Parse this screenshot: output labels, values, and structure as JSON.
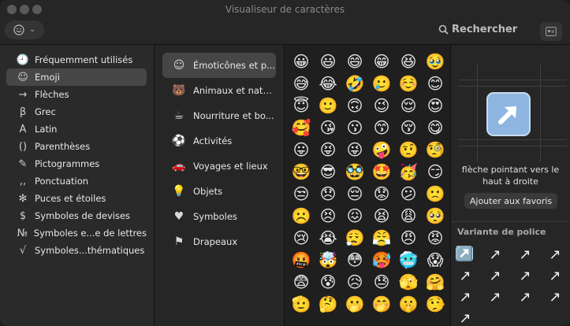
{
  "window": {
    "title": "Visualiseur de caractères"
  },
  "toolbar": {
    "search_label": "Rechercher"
  },
  "sidebar": {
    "items": [
      {
        "icon": "clock-icon",
        "glyph": "🕘",
        "label": "Fréquemment utilisés"
      },
      {
        "icon": "smiley-icon",
        "glyph": "☺",
        "label": "Emoji"
      },
      {
        "icon": "arrow-icon",
        "glyph": "→",
        "label": "Flèches"
      },
      {
        "icon": "beta-icon",
        "glyph": "β",
        "label": "Grec"
      },
      {
        "icon": "latin-a-icon",
        "glyph": "A",
        "label": "Latin"
      },
      {
        "icon": "parentheses-icon",
        "glyph": "()",
        "label": "Parenthèses"
      },
      {
        "icon": "pictogram-icon",
        "glyph": "✎",
        "label": "Pictogrammes"
      },
      {
        "icon": "punctuation-icon",
        "glyph": ",,",
        "label": "Ponctuation"
      },
      {
        "icon": "bullets-icon",
        "glyph": "✻",
        "label": "Puces et étoiles"
      },
      {
        "icon": "dollar-icon",
        "glyph": "$",
        "label": "Symboles de devises"
      },
      {
        "icon": "numero-icon",
        "glyph": "№",
        "label": "Symboles e...e de lettres"
      },
      {
        "icon": "sqrt-icon",
        "glyph": "√",
        "label": "Symboles...thématiques"
      }
    ],
    "selected_index": 1
  },
  "categories": {
    "items": [
      {
        "icon": "smiley-icon",
        "glyph": "☺",
        "label": "Émoticônes et p..."
      },
      {
        "icon": "bear-icon",
        "glyph": "🐻",
        "label": "Animaux et natu..."
      },
      {
        "icon": "cup-icon",
        "glyph": "☕",
        "label": "Nourriture et bo..."
      },
      {
        "icon": "ball-icon",
        "glyph": "⚽",
        "label": "Activités"
      },
      {
        "icon": "car-icon",
        "glyph": "🚗",
        "label": "Voyages et lieux"
      },
      {
        "icon": "bulb-icon",
        "glyph": "💡",
        "label": "Objets"
      },
      {
        "icon": "symbols-icon",
        "glyph": "♥",
        "label": "Symboles"
      },
      {
        "icon": "flag-icon",
        "glyph": "⚑",
        "label": "Drapeaux"
      }
    ],
    "selected_index": 0
  },
  "emoji_grid": [
    "😀",
    "😃",
    "😄",
    "😁",
    "😆",
    "🥹",
    "😅",
    "😂",
    "🤣",
    "🥲",
    "☺️",
    "😊",
    "😇",
    "🙂",
    "🙃",
    "😉",
    "😌",
    "😍",
    "🥰",
    "😘",
    "😗",
    "😙",
    "😚",
    "😋",
    "😛",
    "😝",
    "😜",
    "🤪",
    "🤨",
    "🧐",
    "🤓",
    "😎",
    "🥸",
    "🤩",
    "🥳",
    "😏",
    "😒",
    "😞",
    "😔",
    "😟",
    "😕",
    "🙁",
    "☹️",
    "😣",
    "😖",
    "😫",
    "😩",
    "🥺",
    "😢",
    "😭",
    "😮‍💨",
    "😤",
    "😠",
    "😡",
    "🤬",
    "🤯",
    "😳",
    "🥵",
    "🥶",
    "😱",
    "😨",
    "😰",
    "😥",
    "😓",
    "🫣",
    "🤗",
    "🫡",
    "🤔",
    "🫢",
    "🤭",
    "🤫",
    "🤥"
  ],
  "detail": {
    "character_name": "flèche pointant vers le haut à droite",
    "favorite_button": "Ajouter aux favoris",
    "variants_title": "Variante de police",
    "variants": [
      "↗️",
      "↗",
      "↗",
      "↗",
      "↗",
      "↗",
      "↗",
      "↗",
      "↗",
      "↗",
      "↗",
      "↗",
      "↗"
    ],
    "accent_color": "#8fb6e0"
  }
}
